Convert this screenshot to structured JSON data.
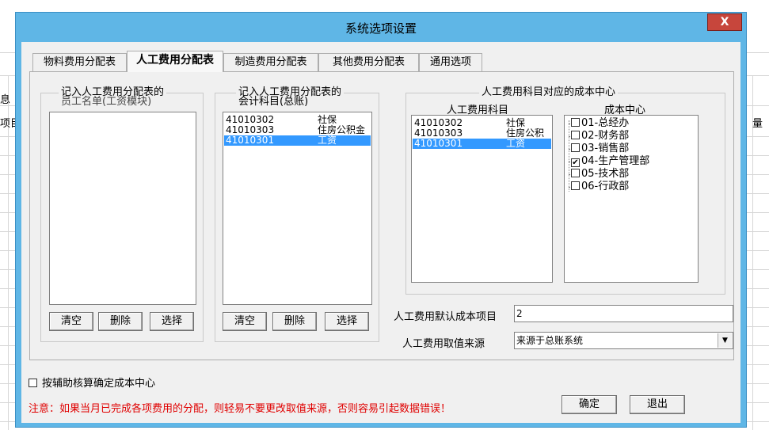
{
  "window": {
    "title": "系统选项设置",
    "close_label": "X"
  },
  "background": {
    "left_text_top": "息",
    "left_text_mid": "项目",
    "right_text": "量"
  },
  "tabs": [
    {
      "label": "物料费用分配表",
      "active": false
    },
    {
      "label": "人工费用分配表",
      "active": true
    },
    {
      "label": "制造费用分配表",
      "active": false
    },
    {
      "label": "其他费用分配表",
      "active": false
    },
    {
      "label": "通用选项",
      "active": false
    }
  ],
  "employee_group": {
    "legend_line1": "记入人工费用分配表的",
    "legend_line2": "员工名单(工资模块)",
    "clear_label": "清空",
    "delete_label": "删除",
    "select_label": "选择"
  },
  "account_group": {
    "legend_line1": "记入人工费用分配表的",
    "legend_line2": "会计科目(总账)",
    "rows": [
      {
        "code": "41010302",
        "name": "社保",
        "selected": false
      },
      {
        "code": "41010303",
        "name": "住房公积金",
        "selected": false
      },
      {
        "code": "41010301",
        "name": "工资",
        "selected": true
      }
    ],
    "clear_label": "清空",
    "delete_label": "删除",
    "select_label": "选择"
  },
  "cost_center_group": {
    "legend": "人工费用科目对应的成本中心",
    "subject_header": "人工费用科目",
    "center_header": "成本中心",
    "subject_rows": [
      {
        "code": "41010302",
        "name": "社保",
        "selected": false
      },
      {
        "code": "41010303",
        "name": "住房公积",
        "selected": false
      },
      {
        "code": "41010301",
        "name": "工资",
        "selected": true
      }
    ],
    "centers": [
      {
        "label": "01-总经办",
        "checked": false,
        "mark": ""
      },
      {
        "label": "02-财务部",
        "checked": false,
        "mark": ""
      },
      {
        "label": "03-销售部",
        "checked": false,
        "mark": ""
      },
      {
        "label": "04-生产管理部",
        "checked": true,
        "mark": "✔"
      },
      {
        "label": "05-技术部",
        "checked": false,
        "mark": ""
      },
      {
        "label": "06-行政部",
        "checked": false,
        "mark": ""
      }
    ]
  },
  "default_cost_item": {
    "label": "人工费用默认成本项目",
    "value": "2"
  },
  "value_source": {
    "label": "人工费用取值来源",
    "value": "来源于总账系统",
    "arrow": "▼"
  },
  "aux_checkbox": {
    "label": "按辅助核算确定成本中心",
    "checked": false
  },
  "warning": "注意：如果当月已完成各项费用的分配，则轻易不要更改取值来源，否则容易引起数据错误！",
  "confirm_label": "确定",
  "exit_label": "退出"
}
